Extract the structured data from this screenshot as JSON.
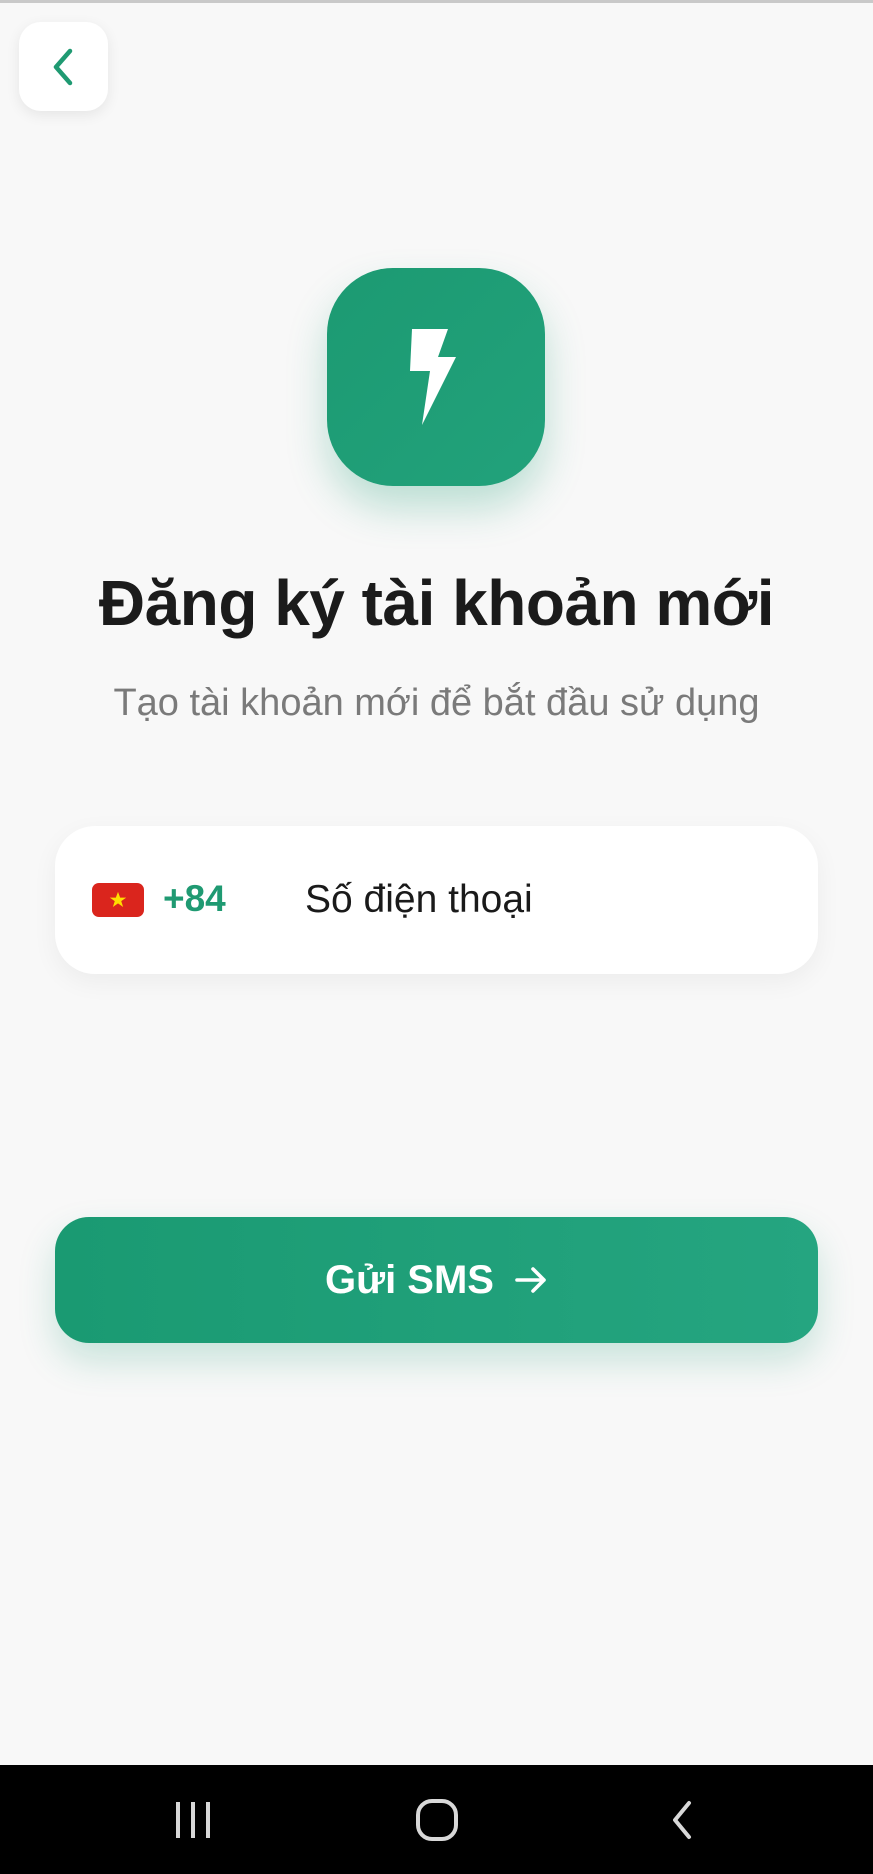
{
  "header": {
    "back_icon": "chevron-left-icon"
  },
  "logo": {
    "icon": "lightning-bolt-icon",
    "color": "#1f9d75"
  },
  "title": "Đăng ký tài khoản mới",
  "subtitle": "Tạo tài khoản mới để bắt đầu sử dụng",
  "phone": {
    "flag_icon": "vietnam-flag-icon",
    "country_code": "+84",
    "placeholder": "Số điện thoại",
    "value": ""
  },
  "send_button": {
    "label": "Gửi SMS",
    "icon": "arrow-right-icon"
  },
  "system_nav": {
    "recent_icon": "recent-apps-icon",
    "home_icon": "home-icon",
    "back_icon": "back-icon"
  },
  "colors": {
    "accent": "#1f9d75",
    "background": "#f8f8f8",
    "title": "#1b1b1b",
    "subtitle": "#7a7a7a"
  }
}
